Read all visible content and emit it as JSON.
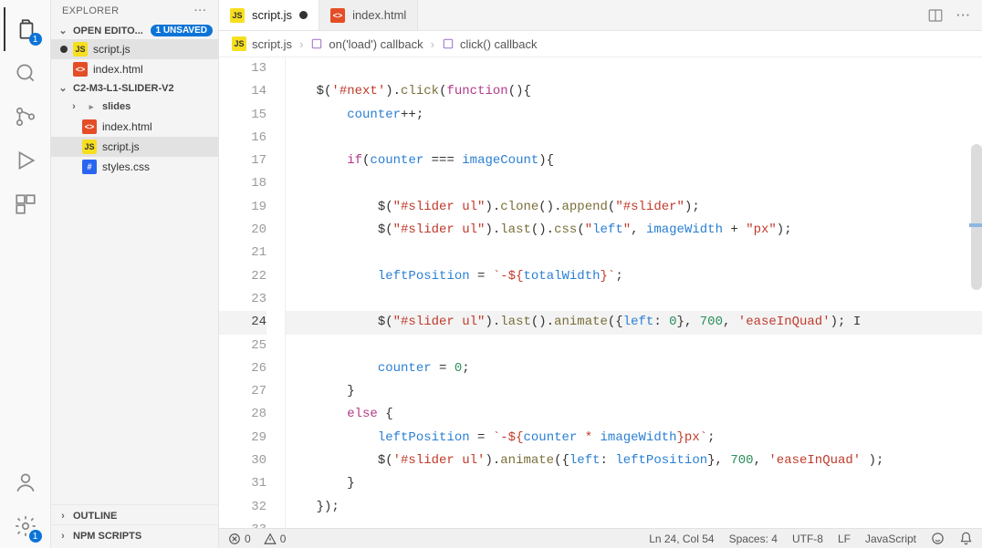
{
  "sidebar": {
    "title": "EXPLORER",
    "openEditors": {
      "label": "OPEN EDITO...",
      "unsavedBadge": "1 UNSAVED",
      "items": [
        {
          "name": "script.js",
          "kind": "js",
          "modified": true
        },
        {
          "name": "index.html",
          "kind": "html",
          "modified": false
        }
      ]
    },
    "workspace": {
      "name": "C2-M3-L1-SLIDER-V2",
      "folders": [
        {
          "name": "slides",
          "expanded": false
        }
      ],
      "files": [
        {
          "name": "index.html",
          "kind": "html",
          "selected": false
        },
        {
          "name": "script.js",
          "kind": "js",
          "selected": true
        },
        {
          "name": "styles.css",
          "kind": "css",
          "selected": false
        }
      ]
    },
    "outlineLabel": "OUTLINE",
    "npmScriptsLabel": "NPM SCRIPTS"
  },
  "activityBar": {
    "explorerBadge": "1",
    "gearBadge": "1"
  },
  "tabs": [
    {
      "name": "script.js",
      "kind": "js",
      "active": true,
      "modified": true
    },
    {
      "name": "index.html",
      "kind": "html",
      "active": false,
      "modified": false
    }
  ],
  "breadcrumbs": {
    "file": "script.js",
    "crumb1": "on('load') callback",
    "crumb2": "click() callback"
  },
  "editor": {
    "startLine": 13,
    "currentLine": 24,
    "lines": [
      "",
      "    $('#next').click(function(){",
      "        counter++;",
      "",
      "        if(counter === imageCount){",
      "",
      "            $(\"#slider ul\").clone().append(\"#slider\");",
      "            $(\"#slider ul\").last().css(\"left\", imageWidth + \"px\");",
      "",
      "            leftPosition = `-${totalWidth}`;",
      "",
      "            $(\"#slider ul\").last().animate({left: 0}, 700, 'easeInQuad'); I",
      "",
      "            counter = 0;",
      "        }",
      "        else {",
      "            leftPosition = `-${counter * imageWidth}px`;",
      "            $('#slider ul').animate({left: leftPosition}, 700, 'easeInQuad' );",
      "        }",
      "    });",
      ""
    ]
  },
  "statusbar": {
    "errors": "0",
    "warnings": "0",
    "cursor": "Ln 24, Col 54",
    "spaces": "Spaces: 4",
    "encoding": "UTF-8",
    "eol": "LF",
    "language": "JavaScript"
  }
}
